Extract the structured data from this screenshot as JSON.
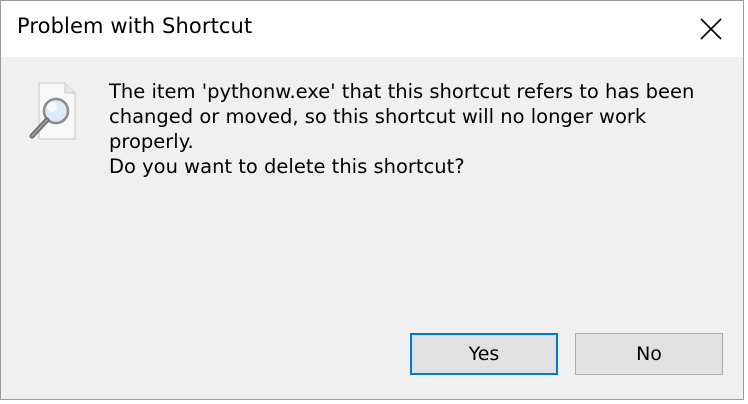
{
  "dialog": {
    "title": "Problem with Shortcut",
    "message_line1": "The item 'pythonw.exe' that this shortcut refers to has been",
    "message_line2": "changed or moved, so this shortcut will no longer work properly.",
    "question": "Do you want to delete this shortcut?",
    "icon": "search-document-icon"
  },
  "buttons": {
    "yes_label": "Yes",
    "no_label": "No",
    "close_icon": "close-icon"
  },
  "colors": {
    "titlebar_bg": "#ffffff",
    "body_bg": "#f0f0f0",
    "button_bg": "#e1e1e1",
    "default_button_border": "#0078d7"
  }
}
